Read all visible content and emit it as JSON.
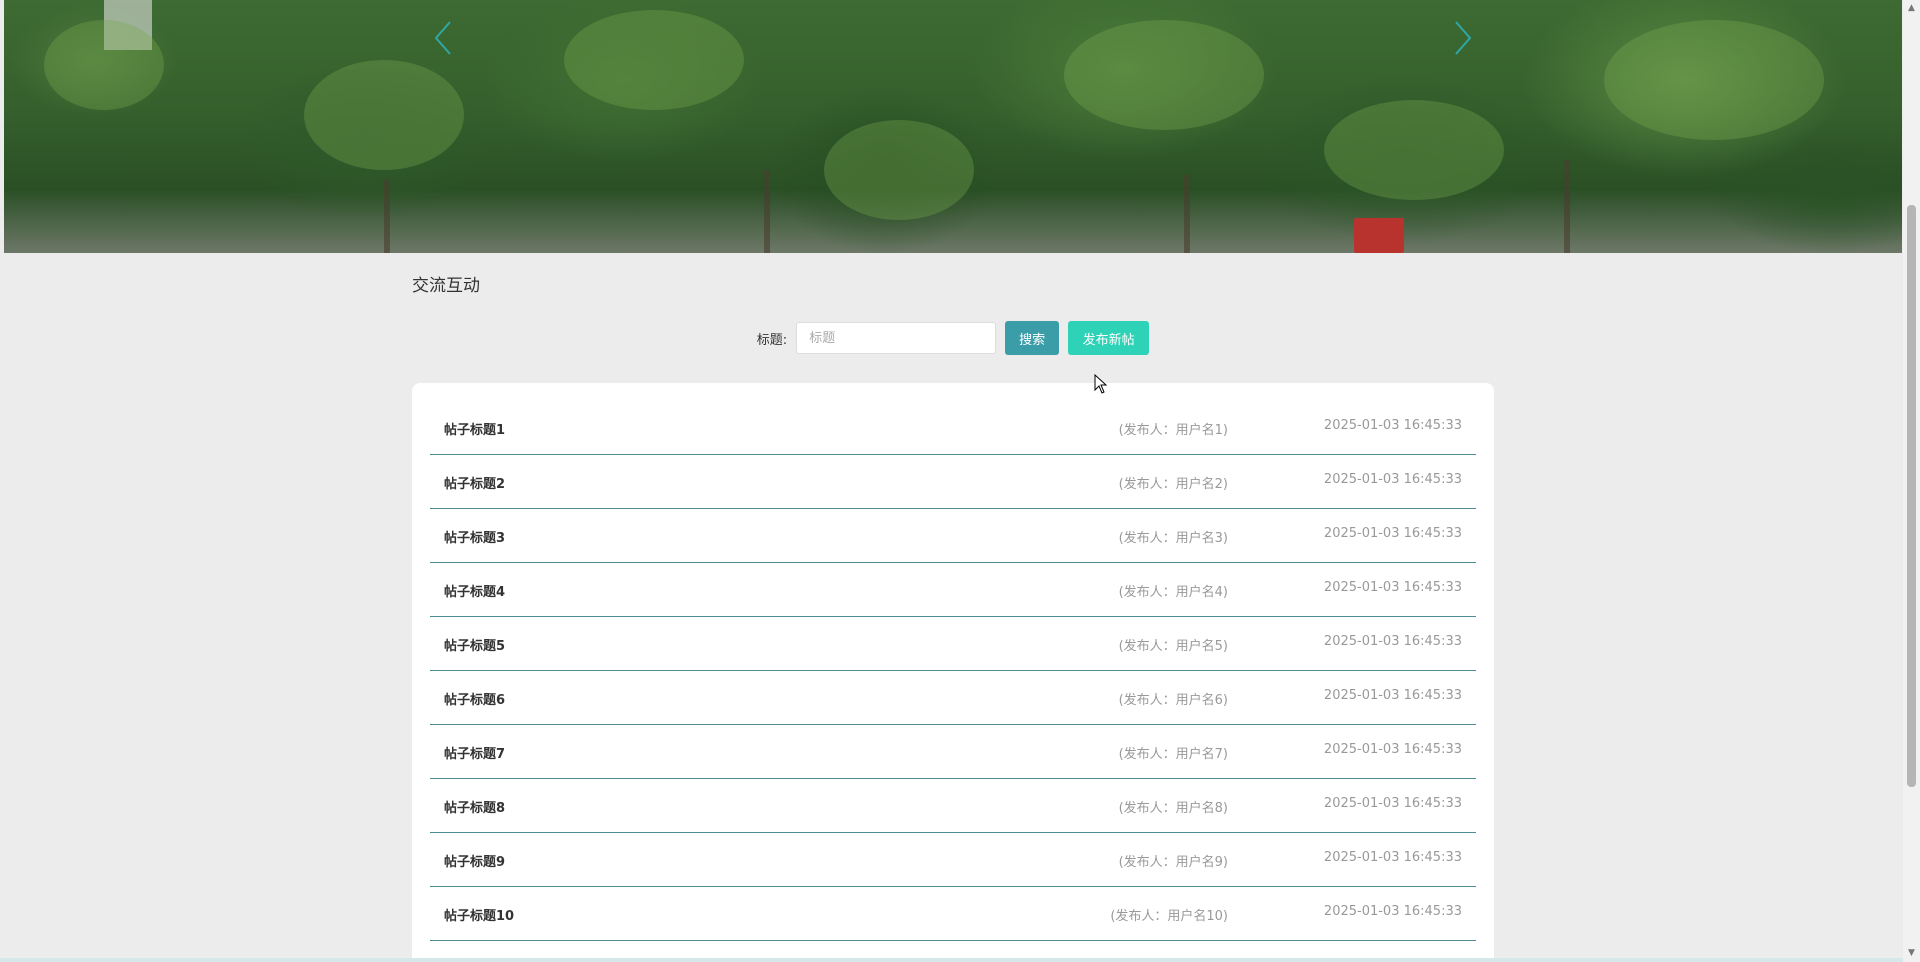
{
  "banner": {
    "prev_icon": "chevron-left-icon",
    "next_icon": "chevron-right-icon",
    "arrow_color": "#2fa7a6"
  },
  "section": {
    "title": "交流互动"
  },
  "search": {
    "label": "标题:",
    "placeholder": "标题",
    "value": "",
    "search_button": "搜索",
    "post_button": "发布新帖",
    "search_button_color": "#3a9da8",
    "post_button_color": "#2ed3b7"
  },
  "posts": [
    {
      "title": "帖子标题1",
      "author": "(发布人：用户名1)",
      "time": "2025-01-03 16:45:33"
    },
    {
      "title": "帖子标题2",
      "author": "(发布人：用户名2)",
      "time": "2025-01-03 16:45:33"
    },
    {
      "title": "帖子标题3",
      "author": "(发布人：用户名3)",
      "time": "2025-01-03 16:45:33"
    },
    {
      "title": "帖子标题4",
      "author": "(发布人：用户名4)",
      "time": "2025-01-03 16:45:33"
    },
    {
      "title": "帖子标题5",
      "author": "(发布人：用户名5)",
      "time": "2025-01-03 16:45:33"
    },
    {
      "title": "帖子标题6",
      "author": "(发布人：用户名6)",
      "time": "2025-01-03 16:45:33"
    },
    {
      "title": "帖子标题7",
      "author": "(发布人：用户名7)",
      "time": "2025-01-03 16:45:33"
    },
    {
      "title": "帖子标题8",
      "author": "(发布人：用户名8)",
      "time": "2025-01-03 16:45:33"
    },
    {
      "title": "帖子标题9",
      "author": "(发布人：用户名9)",
      "time": "2025-01-03 16:45:33"
    },
    {
      "title": "帖子标题10",
      "author": "(发布人：用户名10)",
      "time": "2025-01-03 16:45:33"
    }
  ],
  "colors": {
    "page_background": "#ececec",
    "row_divider": "#4c8c95"
  }
}
